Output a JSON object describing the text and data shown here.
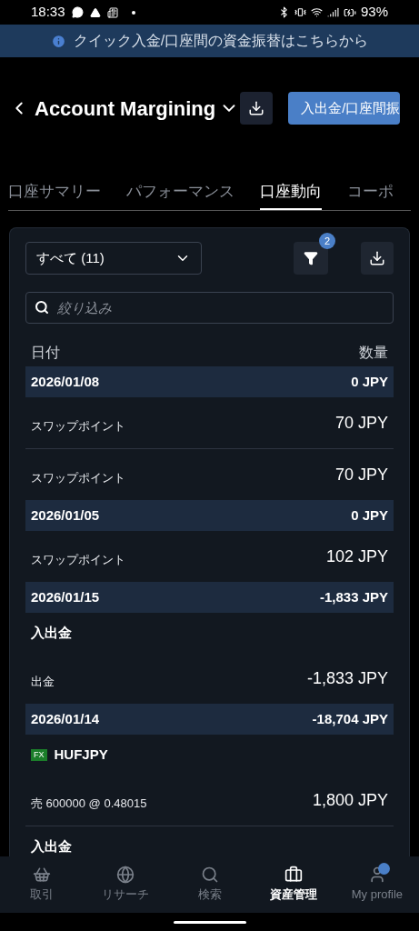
{
  "status_bar": {
    "time": "18:33",
    "battery": "93%"
  },
  "banner": {
    "text": "クイック入金/口座間の資金振替はこちらから"
  },
  "header": {
    "title": "Account Margining",
    "action": "入出金/口座間振"
  },
  "tabs": [
    {
      "label": "口座サマリー",
      "selected": false
    },
    {
      "label": "パフォーマンス",
      "selected": false
    },
    {
      "label": "口座動向",
      "selected": true
    },
    {
      "label": "コーポ",
      "selected": false
    }
  ],
  "filter": {
    "value": "すべて (11)",
    "filter_count": "2"
  },
  "search": {
    "placeholder": "絞り込み"
  },
  "table": {
    "columns": [
      "日付",
      "数量"
    ],
    "rows": [
      {
        "kind": "group",
        "label": "2026/01/08",
        "amount": "0 JPY"
      },
      {
        "kind": "item",
        "label": "スワップポイント",
        "amount": "70 JPY"
      },
      {
        "kind": "item",
        "label": "スワップポイント",
        "amount": "70 JPY"
      },
      {
        "kind": "group",
        "label": "2026/01/05",
        "amount": "0 JPY"
      },
      {
        "kind": "item",
        "label": "スワップポイント",
        "amount": "102 JPY"
      },
      {
        "kind": "group",
        "label": "2026/01/15",
        "amount": "-1,833 JPY"
      },
      {
        "kind": "item",
        "title": "入出金",
        "label": "出金",
        "amount": "-1,833 JPY"
      },
      {
        "kind": "group",
        "label": "2026/01/14",
        "amount": "-18,704 JPY"
      },
      {
        "kind": "item",
        "badge": "FX",
        "title": "HUFJPY",
        "label": "売 600000 @ 0.48015",
        "amount": "1,800 JPY"
      },
      {
        "kind": "item",
        "title": "入出金"
      }
    ]
  },
  "bottom_nav": [
    {
      "label": "取引",
      "selected": false
    },
    {
      "label": "リサーチ",
      "selected": false
    },
    {
      "label": "検索",
      "selected": false
    },
    {
      "label": "資産管理",
      "selected": true
    },
    {
      "label": "My profile",
      "selected": false
    }
  ]
}
